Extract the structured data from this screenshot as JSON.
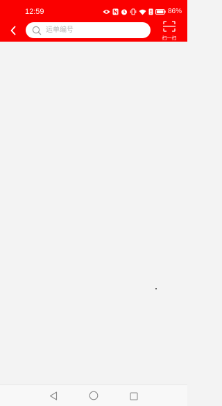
{
  "status_bar": {
    "time": "12:59",
    "battery_percent": "86%",
    "icons": [
      "eye-icon",
      "nfc-icon",
      "alarm-icon",
      "vibrate-icon",
      "wifi-icon",
      "alert-icon",
      "battery-icon"
    ]
  },
  "toolbar": {
    "back_icon": "chevron-left-icon",
    "search": {
      "placeholder": "运单编号",
      "value": ""
    },
    "scan_label": "扫一扫"
  },
  "nav_bar": {
    "buttons": [
      "back-triangle-icon",
      "home-circle-icon",
      "recents-square-icon"
    ]
  },
  "colors": {
    "header": "#fb0000",
    "background": "#f3f3f3",
    "placeholder": "#b5b5b5"
  }
}
